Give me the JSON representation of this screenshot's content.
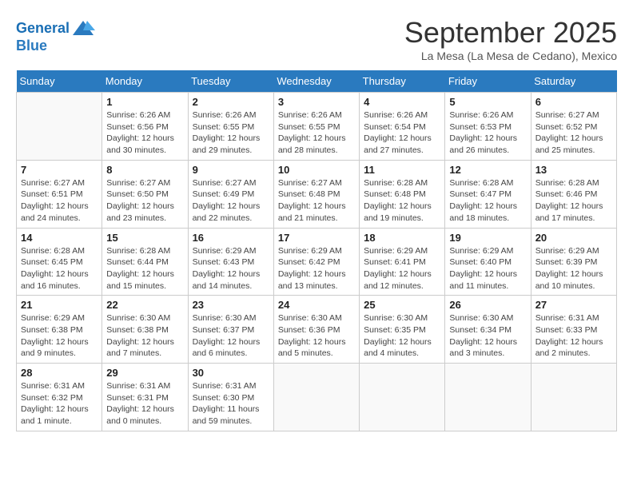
{
  "header": {
    "logo_line1": "General",
    "logo_line2": "Blue",
    "month": "September 2025",
    "location": "La Mesa (La Mesa de Cedano), Mexico"
  },
  "days_of_week": [
    "Sunday",
    "Monday",
    "Tuesday",
    "Wednesday",
    "Thursday",
    "Friday",
    "Saturday"
  ],
  "weeks": [
    [
      {
        "num": "",
        "info": ""
      },
      {
        "num": "1",
        "info": "Sunrise: 6:26 AM\nSunset: 6:56 PM\nDaylight: 12 hours\nand 30 minutes."
      },
      {
        "num": "2",
        "info": "Sunrise: 6:26 AM\nSunset: 6:55 PM\nDaylight: 12 hours\nand 29 minutes."
      },
      {
        "num": "3",
        "info": "Sunrise: 6:26 AM\nSunset: 6:55 PM\nDaylight: 12 hours\nand 28 minutes."
      },
      {
        "num": "4",
        "info": "Sunrise: 6:26 AM\nSunset: 6:54 PM\nDaylight: 12 hours\nand 27 minutes."
      },
      {
        "num": "5",
        "info": "Sunrise: 6:26 AM\nSunset: 6:53 PM\nDaylight: 12 hours\nand 26 minutes."
      },
      {
        "num": "6",
        "info": "Sunrise: 6:27 AM\nSunset: 6:52 PM\nDaylight: 12 hours\nand 25 minutes."
      }
    ],
    [
      {
        "num": "7",
        "info": "Sunrise: 6:27 AM\nSunset: 6:51 PM\nDaylight: 12 hours\nand 24 minutes."
      },
      {
        "num": "8",
        "info": "Sunrise: 6:27 AM\nSunset: 6:50 PM\nDaylight: 12 hours\nand 23 minutes."
      },
      {
        "num": "9",
        "info": "Sunrise: 6:27 AM\nSunset: 6:49 PM\nDaylight: 12 hours\nand 22 minutes."
      },
      {
        "num": "10",
        "info": "Sunrise: 6:27 AM\nSunset: 6:48 PM\nDaylight: 12 hours\nand 21 minutes."
      },
      {
        "num": "11",
        "info": "Sunrise: 6:28 AM\nSunset: 6:48 PM\nDaylight: 12 hours\nand 19 minutes."
      },
      {
        "num": "12",
        "info": "Sunrise: 6:28 AM\nSunset: 6:47 PM\nDaylight: 12 hours\nand 18 minutes."
      },
      {
        "num": "13",
        "info": "Sunrise: 6:28 AM\nSunset: 6:46 PM\nDaylight: 12 hours\nand 17 minutes."
      }
    ],
    [
      {
        "num": "14",
        "info": "Sunrise: 6:28 AM\nSunset: 6:45 PM\nDaylight: 12 hours\nand 16 minutes."
      },
      {
        "num": "15",
        "info": "Sunrise: 6:28 AM\nSunset: 6:44 PM\nDaylight: 12 hours\nand 15 minutes."
      },
      {
        "num": "16",
        "info": "Sunrise: 6:29 AM\nSunset: 6:43 PM\nDaylight: 12 hours\nand 14 minutes."
      },
      {
        "num": "17",
        "info": "Sunrise: 6:29 AM\nSunset: 6:42 PM\nDaylight: 12 hours\nand 13 minutes."
      },
      {
        "num": "18",
        "info": "Sunrise: 6:29 AM\nSunset: 6:41 PM\nDaylight: 12 hours\nand 12 minutes."
      },
      {
        "num": "19",
        "info": "Sunrise: 6:29 AM\nSunset: 6:40 PM\nDaylight: 12 hours\nand 11 minutes."
      },
      {
        "num": "20",
        "info": "Sunrise: 6:29 AM\nSunset: 6:39 PM\nDaylight: 12 hours\nand 10 minutes."
      }
    ],
    [
      {
        "num": "21",
        "info": "Sunrise: 6:29 AM\nSunset: 6:38 PM\nDaylight: 12 hours\nand 9 minutes."
      },
      {
        "num": "22",
        "info": "Sunrise: 6:30 AM\nSunset: 6:38 PM\nDaylight: 12 hours\nand 7 minutes."
      },
      {
        "num": "23",
        "info": "Sunrise: 6:30 AM\nSunset: 6:37 PM\nDaylight: 12 hours\nand 6 minutes."
      },
      {
        "num": "24",
        "info": "Sunrise: 6:30 AM\nSunset: 6:36 PM\nDaylight: 12 hours\nand 5 minutes."
      },
      {
        "num": "25",
        "info": "Sunrise: 6:30 AM\nSunset: 6:35 PM\nDaylight: 12 hours\nand 4 minutes."
      },
      {
        "num": "26",
        "info": "Sunrise: 6:30 AM\nSunset: 6:34 PM\nDaylight: 12 hours\nand 3 minutes."
      },
      {
        "num": "27",
        "info": "Sunrise: 6:31 AM\nSunset: 6:33 PM\nDaylight: 12 hours\nand 2 minutes."
      }
    ],
    [
      {
        "num": "28",
        "info": "Sunrise: 6:31 AM\nSunset: 6:32 PM\nDaylight: 12 hours\nand 1 minute."
      },
      {
        "num": "29",
        "info": "Sunrise: 6:31 AM\nSunset: 6:31 PM\nDaylight: 12 hours\nand 0 minutes."
      },
      {
        "num": "30",
        "info": "Sunrise: 6:31 AM\nSunset: 6:30 PM\nDaylight: 11 hours\nand 59 minutes."
      },
      {
        "num": "",
        "info": ""
      },
      {
        "num": "",
        "info": ""
      },
      {
        "num": "",
        "info": ""
      },
      {
        "num": "",
        "info": ""
      }
    ]
  ]
}
